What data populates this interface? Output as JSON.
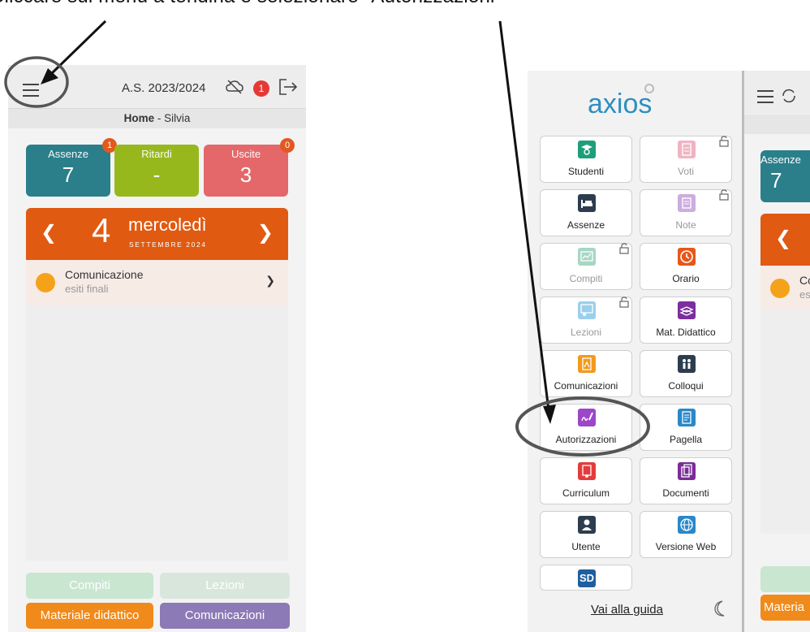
{
  "instruction": "Cliccare sul menù a tendina e selezionare \"Autorizzazioni\"",
  "left_app": {
    "school_year": "A.S. 2023/2024",
    "notification_count": "1",
    "breadcrumb_page": "Home",
    "breadcrumb_user": " - Silvia",
    "stats": [
      {
        "label": "Assenze",
        "value": "7",
        "badge": "1",
        "color": "#2a7f8b"
      },
      {
        "label": "Ritardi",
        "value": "-",
        "badge": "",
        "color": "#97b81d"
      },
      {
        "label": "Uscite",
        "value": "3",
        "badge": "0",
        "color": "#e4686a"
      }
    ],
    "date": {
      "prev": "❮",
      "day": "4",
      "weekday": "mercoledì",
      "month_year": "SETTEMBRE 2024",
      "next": "❯"
    },
    "communication": {
      "title": "Comunicazione",
      "subtitle": "esiti finali",
      "chevron": "❯"
    },
    "buttons": [
      {
        "label": "Compiti",
        "color": "#c8e6d0"
      },
      {
        "label": "Lezioni",
        "color": "#d9e6dc"
      },
      {
        "label": "Materiale didattico",
        "color": "#f08a1a"
      },
      {
        "label": "Comunicazioni",
        "color": "#8b7ab5"
      }
    ]
  },
  "menu": {
    "logo_text": "axios",
    "tiles": [
      {
        "label": "Studenti",
        "icon": "graduate-icon",
        "color": "#1f9e7a",
        "locked": false
      },
      {
        "label": "Voti",
        "icon": "grades-icon",
        "color": "#e16b86",
        "locked": true
      },
      {
        "label": "Assenze",
        "icon": "bed-icon",
        "color": "#2d3d4f",
        "locked": false
      },
      {
        "label": "Note",
        "icon": "note-icon",
        "color": "#9b5cc4",
        "locked": true
      },
      {
        "label": "Compiti",
        "icon": "chart-icon",
        "color": "#4fb08a",
        "locked": true
      },
      {
        "label": "Orario",
        "icon": "clock-icon",
        "color": "#e5571a",
        "locked": false
      },
      {
        "label": "Lezioni",
        "icon": "teacher-icon",
        "color": "#3aa0d8",
        "locked": true
      },
      {
        "label": "Mat. Didattico",
        "icon": "books-icon",
        "color": "#7c2d9e",
        "locked": false
      },
      {
        "label": "Comunicazioni",
        "icon": "pdf-icon",
        "color": "#f29a1d",
        "locked": false
      },
      {
        "label": "Colloqui",
        "icon": "people-icon",
        "color": "#2d3d4f",
        "locked": false
      },
      {
        "label": "Autorizzazioni",
        "icon": "signature-icon",
        "color": "#9b47c8",
        "locked": false
      },
      {
        "label": "Pagella",
        "icon": "report-icon",
        "color": "#2a88c8",
        "locked": false
      },
      {
        "label": "Curriculum",
        "icon": "certificate-icon",
        "color": "#e53b3b",
        "locked": false
      },
      {
        "label": "Documenti",
        "icon": "documents-icon",
        "color": "#7a2d96",
        "locked": false
      },
      {
        "label": "Utente",
        "icon": "user-icon",
        "color": "#2d3d4f",
        "locked": false
      },
      {
        "label": "Versione Web",
        "icon": "globe-icon",
        "color": "#2a88c8",
        "locked": false
      },
      {
        "label": "SD",
        "icon": "sd-icon",
        "color": "#1f5f9e",
        "locked": false
      }
    ],
    "guide_link": "Vai alla guida"
  },
  "right_app": {
    "stat_label": "Assenze",
    "stat_value": "7",
    "date_prev": "❮",
    "comm_initial": "Co",
    "comm_sub_initial": "es",
    "bottom_button": "Materia"
  }
}
